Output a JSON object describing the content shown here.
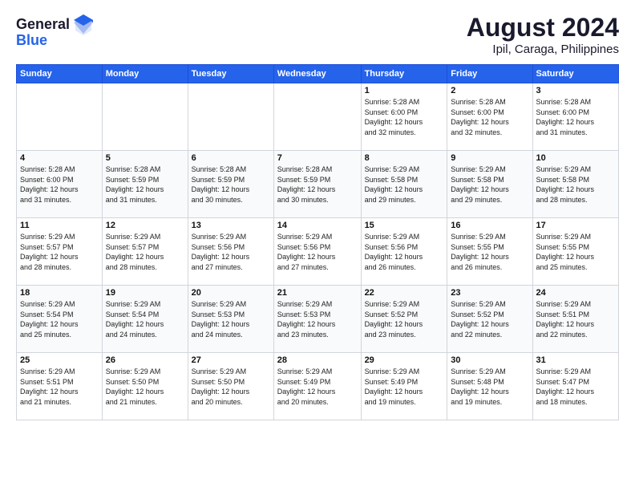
{
  "header": {
    "logo_general": "General",
    "logo_blue": "Blue",
    "month_year": "August 2024",
    "location": "Ipil, Caraga, Philippines"
  },
  "weekdays": [
    "Sunday",
    "Monday",
    "Tuesday",
    "Wednesday",
    "Thursday",
    "Friday",
    "Saturday"
  ],
  "weeks": [
    [
      {
        "day": "",
        "info": ""
      },
      {
        "day": "",
        "info": ""
      },
      {
        "day": "",
        "info": ""
      },
      {
        "day": "",
        "info": ""
      },
      {
        "day": "1",
        "info": "Sunrise: 5:28 AM\nSunset: 6:00 PM\nDaylight: 12 hours\nand 32 minutes."
      },
      {
        "day": "2",
        "info": "Sunrise: 5:28 AM\nSunset: 6:00 PM\nDaylight: 12 hours\nand 32 minutes."
      },
      {
        "day": "3",
        "info": "Sunrise: 5:28 AM\nSunset: 6:00 PM\nDaylight: 12 hours\nand 31 minutes."
      }
    ],
    [
      {
        "day": "4",
        "info": "Sunrise: 5:28 AM\nSunset: 6:00 PM\nDaylight: 12 hours\nand 31 minutes."
      },
      {
        "day": "5",
        "info": "Sunrise: 5:28 AM\nSunset: 5:59 PM\nDaylight: 12 hours\nand 31 minutes."
      },
      {
        "day": "6",
        "info": "Sunrise: 5:28 AM\nSunset: 5:59 PM\nDaylight: 12 hours\nand 30 minutes."
      },
      {
        "day": "7",
        "info": "Sunrise: 5:28 AM\nSunset: 5:59 PM\nDaylight: 12 hours\nand 30 minutes."
      },
      {
        "day": "8",
        "info": "Sunrise: 5:29 AM\nSunset: 5:58 PM\nDaylight: 12 hours\nand 29 minutes."
      },
      {
        "day": "9",
        "info": "Sunrise: 5:29 AM\nSunset: 5:58 PM\nDaylight: 12 hours\nand 29 minutes."
      },
      {
        "day": "10",
        "info": "Sunrise: 5:29 AM\nSunset: 5:58 PM\nDaylight: 12 hours\nand 28 minutes."
      }
    ],
    [
      {
        "day": "11",
        "info": "Sunrise: 5:29 AM\nSunset: 5:57 PM\nDaylight: 12 hours\nand 28 minutes."
      },
      {
        "day": "12",
        "info": "Sunrise: 5:29 AM\nSunset: 5:57 PM\nDaylight: 12 hours\nand 28 minutes."
      },
      {
        "day": "13",
        "info": "Sunrise: 5:29 AM\nSunset: 5:56 PM\nDaylight: 12 hours\nand 27 minutes."
      },
      {
        "day": "14",
        "info": "Sunrise: 5:29 AM\nSunset: 5:56 PM\nDaylight: 12 hours\nand 27 minutes."
      },
      {
        "day": "15",
        "info": "Sunrise: 5:29 AM\nSunset: 5:56 PM\nDaylight: 12 hours\nand 26 minutes."
      },
      {
        "day": "16",
        "info": "Sunrise: 5:29 AM\nSunset: 5:55 PM\nDaylight: 12 hours\nand 26 minutes."
      },
      {
        "day": "17",
        "info": "Sunrise: 5:29 AM\nSunset: 5:55 PM\nDaylight: 12 hours\nand 25 minutes."
      }
    ],
    [
      {
        "day": "18",
        "info": "Sunrise: 5:29 AM\nSunset: 5:54 PM\nDaylight: 12 hours\nand 25 minutes."
      },
      {
        "day": "19",
        "info": "Sunrise: 5:29 AM\nSunset: 5:54 PM\nDaylight: 12 hours\nand 24 minutes."
      },
      {
        "day": "20",
        "info": "Sunrise: 5:29 AM\nSunset: 5:53 PM\nDaylight: 12 hours\nand 24 minutes."
      },
      {
        "day": "21",
        "info": "Sunrise: 5:29 AM\nSunset: 5:53 PM\nDaylight: 12 hours\nand 23 minutes."
      },
      {
        "day": "22",
        "info": "Sunrise: 5:29 AM\nSunset: 5:52 PM\nDaylight: 12 hours\nand 23 minutes."
      },
      {
        "day": "23",
        "info": "Sunrise: 5:29 AM\nSunset: 5:52 PM\nDaylight: 12 hours\nand 22 minutes."
      },
      {
        "day": "24",
        "info": "Sunrise: 5:29 AM\nSunset: 5:51 PM\nDaylight: 12 hours\nand 22 minutes."
      }
    ],
    [
      {
        "day": "25",
        "info": "Sunrise: 5:29 AM\nSunset: 5:51 PM\nDaylight: 12 hours\nand 21 minutes."
      },
      {
        "day": "26",
        "info": "Sunrise: 5:29 AM\nSunset: 5:50 PM\nDaylight: 12 hours\nand 21 minutes."
      },
      {
        "day": "27",
        "info": "Sunrise: 5:29 AM\nSunset: 5:50 PM\nDaylight: 12 hours\nand 20 minutes."
      },
      {
        "day": "28",
        "info": "Sunrise: 5:29 AM\nSunset: 5:49 PM\nDaylight: 12 hours\nand 20 minutes."
      },
      {
        "day": "29",
        "info": "Sunrise: 5:29 AM\nSunset: 5:49 PM\nDaylight: 12 hours\nand 19 minutes."
      },
      {
        "day": "30",
        "info": "Sunrise: 5:29 AM\nSunset: 5:48 PM\nDaylight: 12 hours\nand 19 minutes."
      },
      {
        "day": "31",
        "info": "Sunrise: 5:29 AM\nSunset: 5:47 PM\nDaylight: 12 hours\nand 18 minutes."
      }
    ]
  ]
}
